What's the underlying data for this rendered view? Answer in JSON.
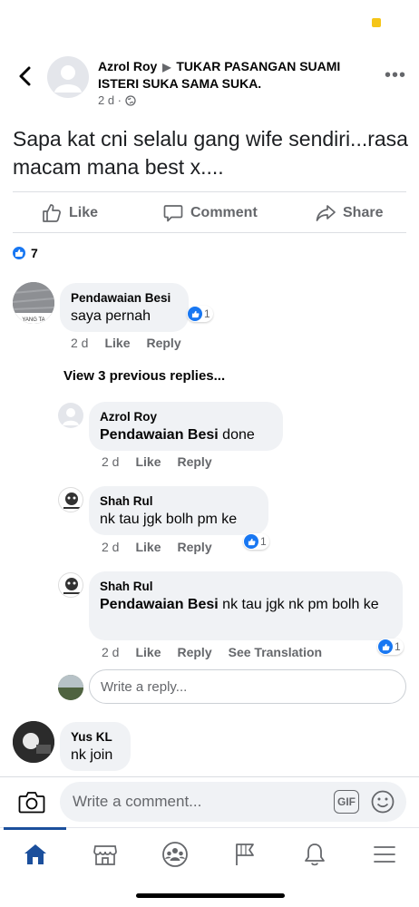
{
  "post": {
    "author": "Azrol Roy",
    "group": "TUKAR PASANGAN SUAMI ISTERI SUKA SAMA SUKA.",
    "time": "2 d ·",
    "text": "Sapa kat cni selalu gang wife sendiri...rasa macam mana best x....",
    "actions": {
      "like": "Like",
      "comment": "Comment",
      "share": "Share"
    },
    "reaction_count": "7"
  },
  "comments": [
    {
      "name": "Pendawaian Besi",
      "text": "saya pernah",
      "time": "2 d",
      "like": "Like",
      "reply": "Reply",
      "reactions": "1",
      "avatar_caption": "YANG TA"
    }
  ],
  "view_previous": "View 3 previous replies...",
  "replies": [
    {
      "name": "Azrol Roy",
      "mention": "Pendawaian Besi",
      "text": " done",
      "time": "2 d",
      "like": "Like",
      "reply": "Reply"
    },
    {
      "name": "Shah Rul",
      "mention": "",
      "text": "nk tau jgk bolh pm ke",
      "time": "2 d",
      "like": "Like",
      "reply": "Reply",
      "reactions": "1"
    },
    {
      "name": "Shah Rul",
      "mention": "Pendawaian Besi",
      "text": " nk tau jgk nk pm bolh ke",
      "time": "2 d",
      "like": "Like",
      "reply": "Reply",
      "translate": "See Translation",
      "reactions": "1"
    }
  ],
  "reply_placeholder": "Write a reply...",
  "comment2": {
    "name": "Yus KL",
    "text": "nk join"
  },
  "composer": {
    "placeholder": "Write a comment...",
    "gif": "GIF"
  },
  "colors": {
    "accent": "#1877f2",
    "tab_active": "#1b4f9c",
    "bubble": "#f0f2f5",
    "secondary_text": "#65676b"
  },
  "tabs": [
    "home-icon",
    "marketplace-icon",
    "groups-icon",
    "pages-icon",
    "notifications-icon",
    "menu-icon"
  ]
}
